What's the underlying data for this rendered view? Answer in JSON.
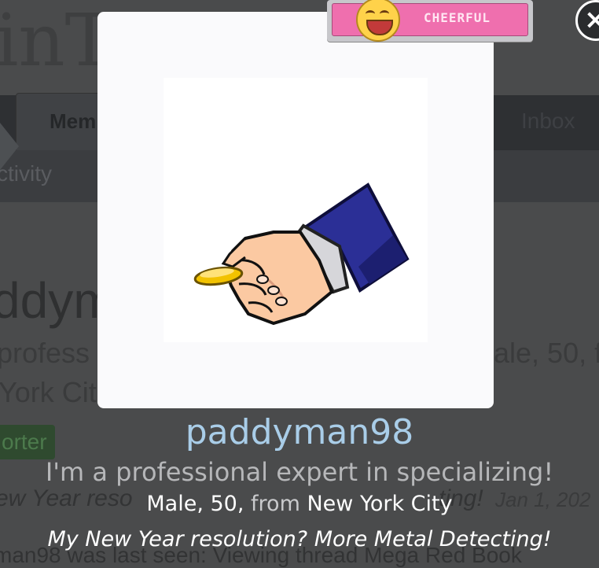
{
  "background": {
    "logo_text": "inT",
    "nav_tab_label": "Mem",
    "nav_inbox_label": "Inbox",
    "subnav_label": "ctivity",
    "profile_name_fragment": "ddym",
    "tagline_left_fragment": "profess",
    "tagline_right_fragment": "ale, 50, f",
    "location_fragment": "York Cit",
    "badge_fragment": "orter",
    "status_fragment": "ew Year reso",
    "status_fragment_right": "ting!",
    "date_fragment": "Jan 1, 202",
    "last_seen_fragment": "man98 was last seen: Viewing thread Mega Red Book"
  },
  "mood": {
    "label": "CHEERFUL",
    "icon": "cheerful-face-icon",
    "color": "#ef6fae"
  },
  "close": {
    "glyph": "×",
    "icon": "close-icon"
  },
  "profile": {
    "username": "paddyman98",
    "tagline": "I'm a professional expert in specializing!",
    "gender_age": "Male, 50,",
    "from_word": "from",
    "location": "New York City",
    "status": "My New Year resolution? More Metal Detecting!",
    "avatar_icon": "hand-holding-coin-icon",
    "username_color": "#a9cde8"
  }
}
